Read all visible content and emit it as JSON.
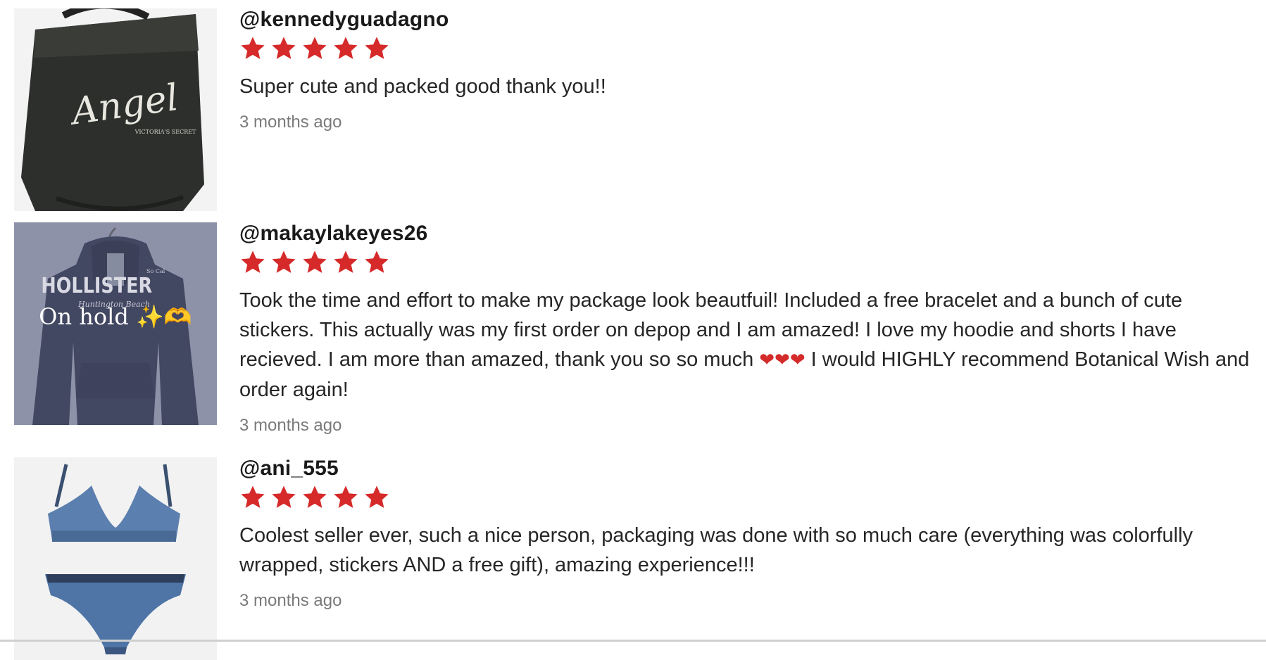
{
  "reviews": [
    {
      "username": "@kennedyguadagno",
      "rating": 5,
      "rating_max": 5,
      "text": "Super cute and packed good thank you!!",
      "time": "3 months ago",
      "thumbnail": {
        "caption": "Angel",
        "brand": "VICTORIA'S SECRET"
      }
    },
    {
      "username": "@makaylakeyes26",
      "rating": 5,
      "rating_max": 5,
      "text_before_hearts": "Took the time and effort to make my package look beautfuil! Included a free bracelet and a bunch of cute stickers. This actually was my first order on depop and I am amazed! I love my hoodie and shorts I have recieved. I am more than amazed, thank you so so much ",
      "hearts": "❤❤❤",
      "text_after_hearts": " I would HIGHLY recommend Botanical Wish and order again!",
      "time": "3 months ago",
      "thumbnail": {
        "brand": "HOLLISTER",
        "subtext": "Huntington Beach",
        "corner": "So Cal",
        "overlay": "On hold ✨🫶"
      }
    },
    {
      "username": "@ani_555",
      "rating": 5,
      "rating_max": 5,
      "text": "Coolest seller ever, such a nice person, packaging was done with so much care (everything was colorfully wrapped, stickers AND a free gift), amazing experience!!!",
      "time": "3 months ago"
    }
  ],
  "colors": {
    "star": "#d62a2a",
    "username": "#1a1a1a",
    "timestamp": "#7a7a7a"
  },
  "icons": {
    "star": "star-icon",
    "heart": "heart-icon"
  }
}
